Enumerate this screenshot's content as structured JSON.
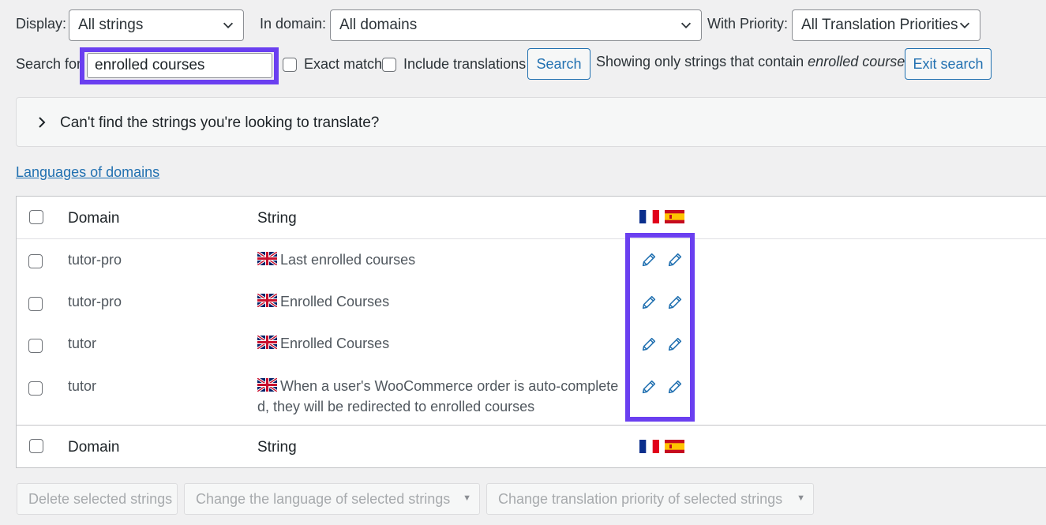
{
  "filters": {
    "display_label": "Display:",
    "display_value": "All strings",
    "domain_label": "In domain:",
    "domain_value": "All domains",
    "priority_label": "With Priority:",
    "priority_value": "All Translation Priorities"
  },
  "search": {
    "label": "Search for:",
    "value": "enrolled courses",
    "exact_match_label": "Exact match",
    "include_translations_label": "Include translations",
    "search_button": "Search",
    "showing_prefix": "Showing only strings that contain",
    "showing_term": "enrolled courses",
    "exit_button": "Exit search"
  },
  "collapsible": {
    "label": "Can't find the strings you're looking to translate?"
  },
  "languages_link": "Languages of domains",
  "table": {
    "col_domain": "Domain",
    "col_string": "String",
    "languages": [
      "fr-flag",
      "es-flag"
    ],
    "rows": [
      {
        "domain": "tutor-pro",
        "string_line1": "Last enrolled courses",
        "string_line2": ""
      },
      {
        "domain": "tutor-pro",
        "string_line1": "Enrolled Courses",
        "string_line2": ""
      },
      {
        "domain": "tutor",
        "string_line1": "Enrolled Courses",
        "string_line2": ""
      },
      {
        "domain": "tutor",
        "string_line1": "When a user's WooCommerce order is auto-complete",
        "string_line2": "d, they will be redirected to enrolled courses"
      }
    ]
  },
  "bulk_actions": {
    "delete": "Delete selected strings",
    "change_language": "Change the language of selected strings",
    "change_priority": "Change translation priority of selected strings"
  },
  "colors": {
    "accent": "#2271b1",
    "highlight": "#6a3ff0",
    "background": "#f0f0f1"
  }
}
